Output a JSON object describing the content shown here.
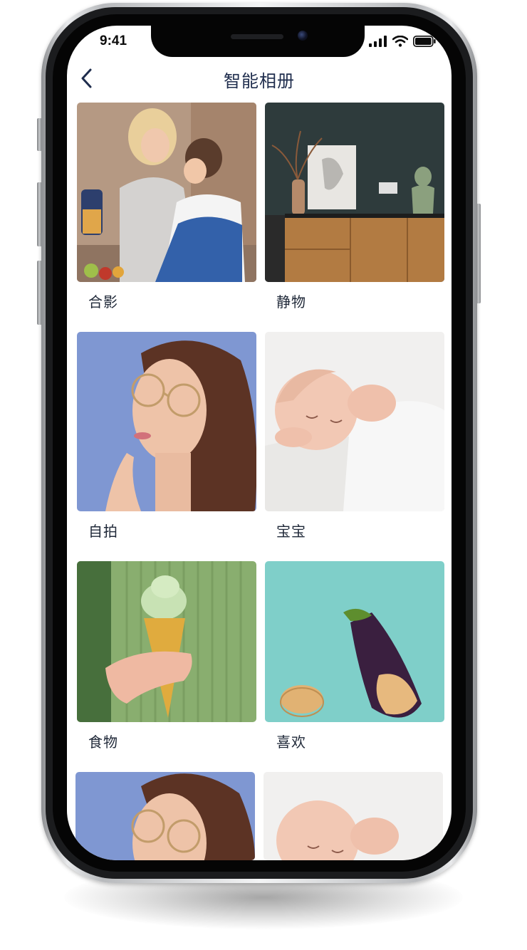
{
  "status_bar": {
    "time": "9:41",
    "signal_icon": "cellular-signal-icon",
    "wifi_icon": "wifi-icon",
    "battery_icon": "battery-icon"
  },
  "nav": {
    "back_icon": "chevron-left-icon",
    "title": "智能相册"
  },
  "albums": [
    {
      "label": "合影"
    },
    {
      "label": "静物"
    },
    {
      "label": "自拍"
    },
    {
      "label": "宝宝"
    },
    {
      "label": "食物"
    },
    {
      "label": "喜欢"
    },
    {
      "label": ""
    },
    {
      "label": ""
    }
  ],
  "colors": {
    "title_text": "#1f2d4d",
    "label_text": "#1f2838",
    "screen_bg": "#ffffff",
    "phone_bezel": "#050505"
  }
}
